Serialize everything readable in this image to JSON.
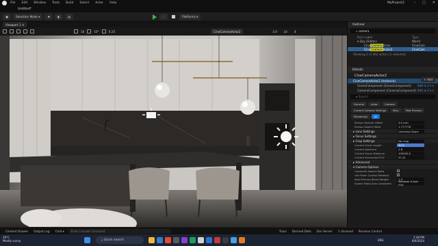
{
  "menu": {
    "items": [
      "File",
      "Edit",
      "Window",
      "Tools",
      "Build",
      "Select",
      "Actor",
      "Help"
    ]
  },
  "project_name": "MyProject2",
  "level_tab": "Untitled*",
  "toolbar": {
    "mode": "Selection Mode",
    "platforms": "Platforms"
  },
  "viewport": {
    "tab": "Viewport 1",
    "values": [
      "10",
      "10°",
      "0.25"
    ],
    "camera": "CineCameraActor2",
    "fov_val": "3.0",
    "lit": "Lit",
    "scale_val": "4"
  },
  "outliner": {
    "tab": "Outliner",
    "search": "camera",
    "header": "Item Label",
    "type_header": "Type",
    "items": [
      {
        "pre": "Day (Editor)",
        "hl": "",
        "post": "",
        "type": "World"
      },
      {
        "pre": "Cine",
        "hl": "Camera",
        "post": "Actor",
        "type": "CineCam"
      },
      {
        "pre": "Cine",
        "hl": "Camera",
        "post": "Actor2",
        "type": "CineCam"
      }
    ],
    "status": "Showing 2 of 462 actors (1 selected)"
  },
  "details": {
    "tab": "Details",
    "title": "CineCameraActor2",
    "add_label": "+ Add",
    "components": [
      {
        "label": "CineCameraActor2 (Instance)",
        "edit": ""
      },
      {
        "label": "SceneComponent (SceneComponent)",
        "edit": "Edit in C++"
      },
      {
        "label": "CameraComponent (CameraComponent)",
        "edit": "Edit in C++"
      }
    ],
    "search_placeholder": "Search",
    "chips": [
      {
        "label": "General",
        "active": false
      },
      {
        "label": "Actor",
        "active": false
      },
      {
        "label": "Camera",
        "active": false
      },
      {
        "label": "Current Camera Settings",
        "active": false
      },
      {
        "label": "Misc",
        "active": false
      },
      {
        "label": "Post Process",
        "active": false
      },
      {
        "label": "Streaming",
        "active": false
      },
      {
        "label": "All",
        "active": true
      }
    ],
    "props_top": [
      {
        "label": "Sensor Vertical Offset",
        "value": "0.0 mm"
      },
      {
        "label": "Sensor Aspect Ratio",
        "value": "1.777778"
      }
    ],
    "sections": [
      {
        "title": "Lens Settings",
        "value": "Universal Zoom"
      },
      {
        "title": "Focus Settings",
        "value": ""
      },
      {
        "title": "Crop Settings",
        "value": "No Crop"
      }
    ],
    "props_mid": [
      {
        "label": "Current Focal Length",
        "value": "30.0",
        "sel": true
      },
      {
        "label": "Current Aperture",
        "value": "2.8",
        "sel": false
      },
      {
        "label": "Current Focus Distance",
        "value": "100000.0",
        "sel": false
      },
      {
        "label": "Current Horizontal FOV",
        "value": "57.41",
        "sel": false
      }
    ],
    "advanced": "Advanced",
    "camera_options": "Camera Options",
    "props_bottom": [
      {
        "label": "Constrain Aspect Ratio",
        "value": ""
      },
      {
        "label": "Use Pawn Control Rotation",
        "value": ""
      },
      {
        "label": "Post Process Blend Weight",
        "value": "1.0"
      },
      {
        "label": "Aspect Ratio Axis Constraint",
        "value": "Maintain X-Axis FOV"
      }
    ]
  },
  "statusbar": {
    "content_drawer": "Content Drawer",
    "output_log": "Output Log",
    "cmd": "Cmd",
    "cmd_placeholder": "Enter Console Command",
    "trace": "Trace",
    "derived": "Derived Data",
    "zen": "Zen Server",
    "unsaved": "1 Unsaved",
    "revision": "Revision Control"
  },
  "taskbar": {
    "weather_temp": "29°C",
    "weather_desc": "Mostly sunny",
    "search": "Quick search",
    "lang": "ENG",
    "time": "2:38 PM",
    "date": "8/9/2024"
  },
  "colors": {
    "accent": "#2f5f8f",
    "play": "#45b140",
    "chip_active": "#1d6fd8"
  }
}
